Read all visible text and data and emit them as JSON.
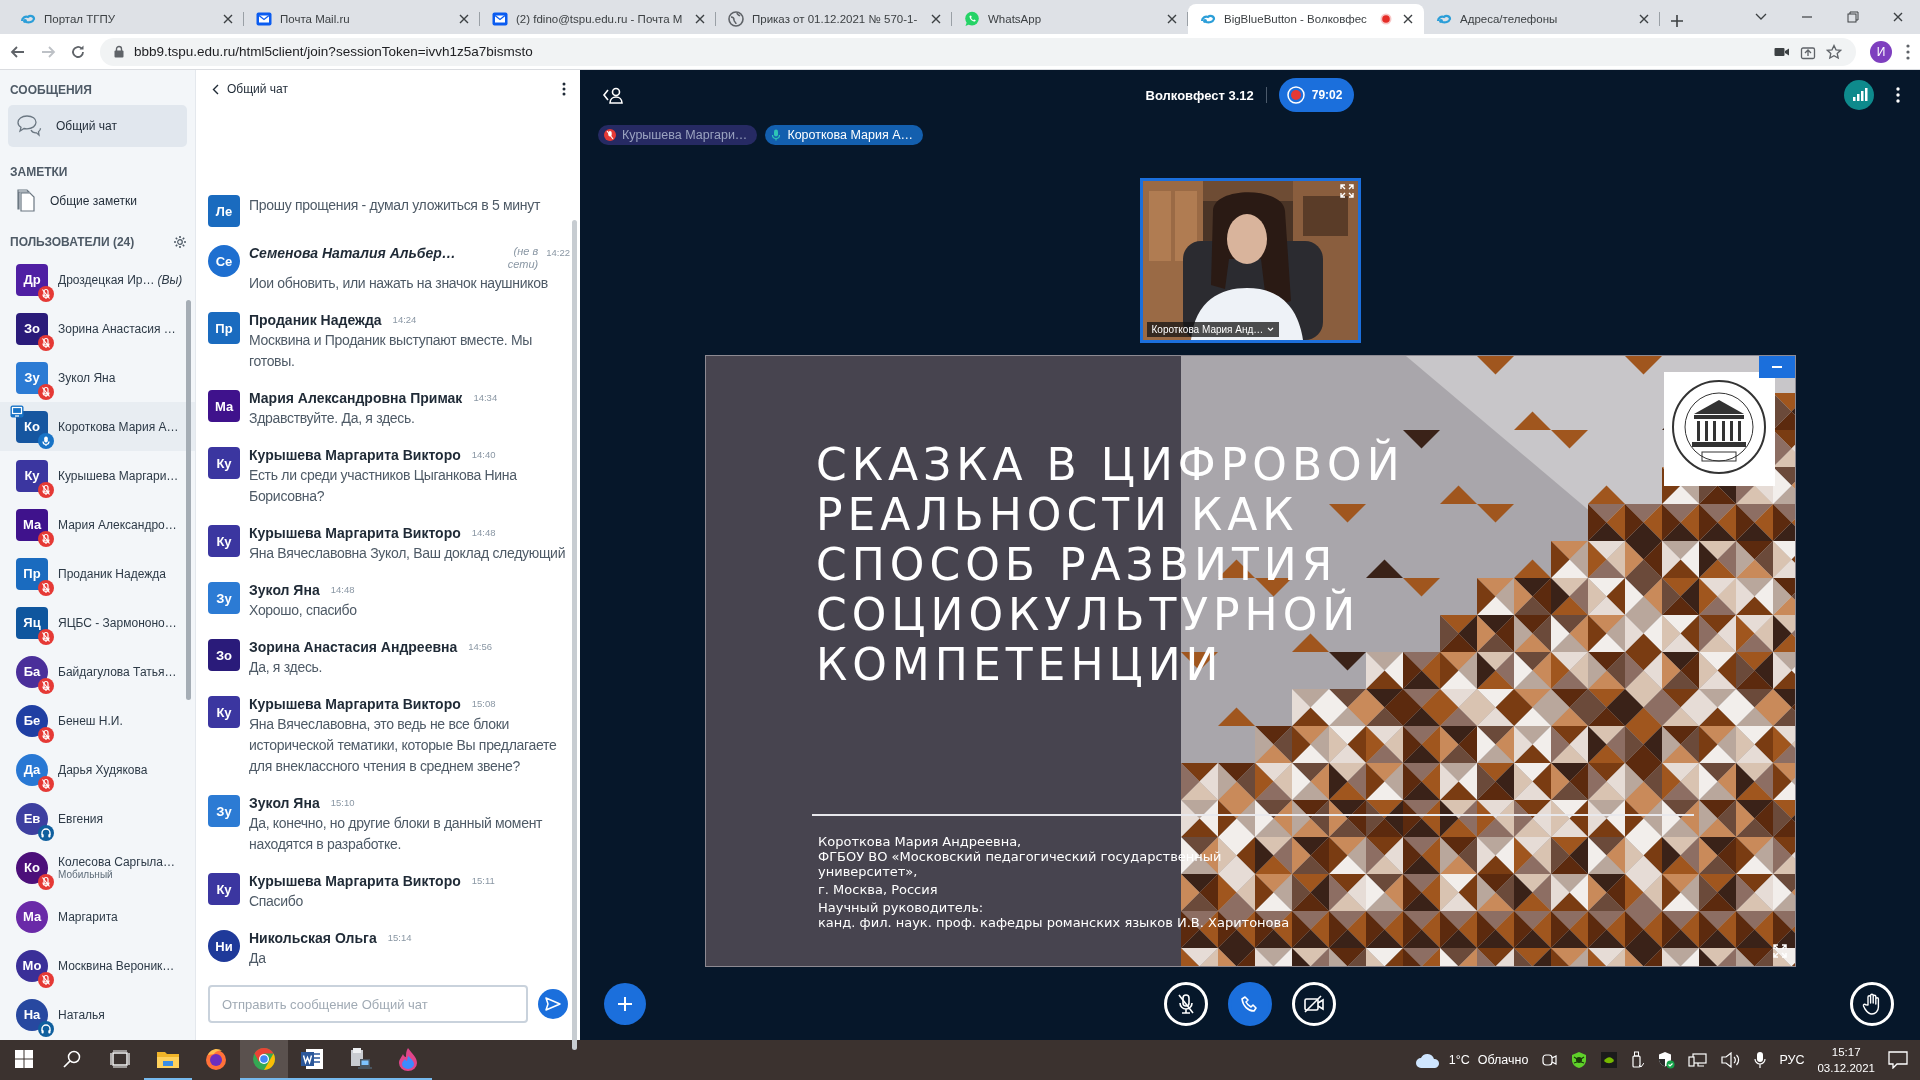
{
  "browser": {
    "tabs": [
      {
        "title": "Портал ТГПУ",
        "kind": "portal",
        "selected": false,
        "recording": false
      },
      {
        "title": "Почта Mail.ru",
        "kind": "mail",
        "selected": false,
        "recording": false
      },
      {
        "title": "(2) fdino@tspu.edu.ru - Почта M",
        "kind": "mail",
        "selected": false,
        "recording": false
      },
      {
        "title": "Приказ от 01.12.2021 № 570-1-",
        "kind": "globe",
        "selected": false,
        "recording": false
      },
      {
        "title": "WhatsApp",
        "kind": "whatsapp",
        "selected": false,
        "recording": false
      },
      {
        "title": "BigBlueButton - Волковфес",
        "kind": "portal",
        "selected": true,
        "recording": true
      },
      {
        "title": "Адреса/телефоны",
        "kind": "portal",
        "selected": false,
        "recording": false
      }
    ],
    "address": "bbb9.tspu.edu.ru/html5client/join?sessionToken=ivvh1z5a7bismsto",
    "profile_initial": "И"
  },
  "sidebar": {
    "messages_title": "СООБЩЕНИЯ",
    "chats": [
      {
        "label": "Общий чат",
        "selected": true
      }
    ],
    "notes_title": "ЗАМЕТКИ",
    "notes": [
      {
        "label": "Общие заметки"
      }
    ],
    "users_title": "ПОЛЬЗОВАТЕЛИ (24)",
    "users": [
      {
        "initials": "Др",
        "name": "Дроздецкая Ир…",
        "you_label": "(Вы)",
        "color": "#4f1fa3",
        "moderator": true,
        "muted": true,
        "listen_only": false,
        "talking": false,
        "presenter": false
      },
      {
        "initials": "Зо",
        "name": "Зорина Анастасия …",
        "color": "#2a1b7a",
        "moderator": true,
        "muted": true,
        "listen_only": false,
        "talking": false,
        "presenter": false
      },
      {
        "initials": "Зу",
        "name": "Зукол Яна",
        "color": "#2c7bd4",
        "moderator": true,
        "muted": true,
        "listen_only": false,
        "talking": false,
        "presenter": false
      },
      {
        "initials": "Ко",
        "name": "Короткова Мария А…",
        "color": "#1656a0",
        "moderator": true,
        "muted": false,
        "listen_only": false,
        "talking": true,
        "presenter": true
      },
      {
        "initials": "Ку",
        "name": "Курышева Маргари…",
        "color": "#3b36a0",
        "moderator": true,
        "muted": true,
        "listen_only": false,
        "talking": false,
        "presenter": false
      },
      {
        "initials": "Ма",
        "name": "Мария Александро…",
        "color": "#3f128c",
        "moderator": true,
        "muted": true,
        "listen_only": false,
        "talking": false,
        "presenter": false
      },
      {
        "initials": "Пр",
        "name": "Проданик Надежда",
        "color": "#1a6bbf",
        "moderator": true,
        "muted": true,
        "listen_only": false,
        "talking": false,
        "presenter": false
      },
      {
        "initials": "Яц",
        "name": "ЯЦБС - Зармононо…",
        "color": "#0f569e",
        "moderator": true,
        "muted": true,
        "listen_only": false,
        "talking": false,
        "presenter": false
      },
      {
        "initials": "Ба",
        "name": "Байдагулова Татья…",
        "color": "#4a2f9a",
        "moderator": false,
        "muted": true,
        "listen_only": false,
        "talking": false,
        "presenter": false
      },
      {
        "initials": "Бе",
        "name": "Бенеш Н.И.",
        "color": "#1f3fa3",
        "moderator": false,
        "muted": true,
        "listen_only": false,
        "talking": false,
        "presenter": false
      },
      {
        "initials": "Да",
        "name": "Дарья Худякова",
        "color": "#2878d4",
        "moderator": false,
        "muted": true,
        "listen_only": false,
        "talking": false,
        "presenter": false
      },
      {
        "initials": "Ев",
        "name": "Евгения",
        "color": "#3d3fa0",
        "moderator": false,
        "muted": false,
        "listen_only": true,
        "talking": false,
        "presenter": false
      },
      {
        "initials": "Ко",
        "name": "Колесова Саргыла…",
        "device": "Мобильный",
        "color": "#4c0f7a",
        "moderator": false,
        "muted": true,
        "listen_only": false,
        "talking": false,
        "presenter": false
      },
      {
        "initials": "Ма",
        "name": "Маргарита",
        "color": "#6a2aa8",
        "moderator": false,
        "muted": false,
        "listen_only": false,
        "talking": false,
        "presenter": false
      },
      {
        "initials": "Мо",
        "name": "Москвина Вероник…",
        "color": "#3a2f98",
        "moderator": false,
        "muted": true,
        "listen_only": false,
        "talking": false,
        "presenter": false
      },
      {
        "initials": "На",
        "name": "Наталья",
        "color": "#2748a0",
        "moderator": false,
        "muted": false,
        "listen_only": true,
        "talking": false,
        "presenter": false
      }
    ]
  },
  "chat": {
    "title": "Общий чат",
    "messages": [
      {
        "initials": "Ле",
        "color": "#1a6bbf",
        "moderator": true,
        "text": "Прошу прощения - думал уложиться в 5 минут"
      },
      {
        "initials": "Се",
        "color": "#1e6fd0",
        "moderator": false,
        "name": "Семенова Наталия Альбер…",
        "offline": true,
        "offline_label": "(не в сети)",
        "time": "14:22",
        "text": "Иои обновить, или нажать на значок наушников"
      },
      {
        "initials": "Пр",
        "color": "#1a6bbf",
        "moderator": true,
        "name": "Проданик Надежда",
        "offline": false,
        "time": "14:24",
        "text": "Москвина и Проданик выступают вместе. Мы готовы."
      },
      {
        "initials": "Ма",
        "color": "#3f128c",
        "moderator": true,
        "name": "Мария Александровна Примак",
        "offline": false,
        "time": "14:34",
        "text": "Здравствуйте. Да, я здесь."
      },
      {
        "initials": "Ку",
        "color": "#3b36a0",
        "moderator": true,
        "name": "Курышева Маргарита Викторо",
        "offline": false,
        "time": "14:40",
        "text": "Есть ли среди участников Цыганкова Нина Борисовна?"
      },
      {
        "initials": "Ку",
        "color": "#3b36a0",
        "moderator": true,
        "name": "Курышева Маргарита Викторо",
        "offline": false,
        "time": "14:48",
        "text": "Яна Вячеславовна Зукол, Ваш доклад следующий"
      },
      {
        "initials": "Зу",
        "color": "#2c7bd4",
        "moderator": true,
        "name": "Зукол Яна",
        "offline": false,
        "time": "14:48",
        "text": "Хорошо, спасибо"
      },
      {
        "initials": "Зо",
        "color": "#2a1b7a",
        "moderator": true,
        "name": "Зорина Анастасия Андреевна",
        "offline": false,
        "time": "14:56",
        "text": "Да, я здесь."
      },
      {
        "initials": "Ку",
        "color": "#3b36a0",
        "moderator": true,
        "name": "Курышева Маргарита Викторо",
        "offline": false,
        "time": "15:08",
        "text": "Яна Вячеславовна, это ведь не все блоки исторической тематики, которые Вы предлагаете для внеклассного чтения в среднем звене?"
      },
      {
        "initials": "Зу",
        "color": "#2c7bd4",
        "moderator": true,
        "name": "Зукол Яна",
        "offline": false,
        "time": "15:10",
        "text": "Да, конечно, но другие блоки в данный момент находятся в разработке."
      },
      {
        "initials": "Ку",
        "color": "#3b36a0",
        "moderator": true,
        "name": "Курышева Маргарита Викторо",
        "offline": false,
        "time": "15:11",
        "text": "Спасибо"
      },
      {
        "initials": "Ни",
        "color": "#1f3a9a",
        "moderator": false,
        "name": "Никольская Ольга",
        "offline": false,
        "time": "15:14",
        "text": "Да"
      }
    ],
    "input": {
      "placeholder": "Отправить сообщение Общий чат"
    }
  },
  "meeting": {
    "title": "Волковфест 3.12",
    "recording": {
      "on": true,
      "time": "79:02"
    },
    "talkers": [
      {
        "name": "Курышева Маргари…",
        "talking": false
      },
      {
        "name": "Короткова Мария А…",
        "talking": true
      }
    ],
    "webcam": {
      "name": "Короткова Мария Анд…"
    },
    "slide": {
      "title": "СКАЗКА В ЦИФРОВОЙ РЕАЛЬНОСТИ КАК СПОСОБ РАЗВИТИЯ СОЦИОКУЛЬТУРНОЙ КОМПЕТЕНЦИИ",
      "paragraphs": [
        "Короткова Мария Андреевна,\nФГБОУ ВО «Московский педагогический государственный\nуниверситет»,",
        "г. Москва, Россия",
        "Научный руководитель:\nканд. фил. наук. проф. кафедры романских языков И.В. Харитонова"
      ]
    }
  },
  "taskbar": {
    "apps": [
      {
        "kind": "start",
        "active": false,
        "running": false
      },
      {
        "kind": "search",
        "active": false,
        "running": false
      },
      {
        "kind": "taskview",
        "active": false,
        "running": false
      },
      {
        "kind": "folder",
        "active": false,
        "running": true
      },
      {
        "kind": "firefox",
        "active": false,
        "running": false
      },
      {
        "kind": "chrome",
        "active": true,
        "running": true
      },
      {
        "kind": "word",
        "active": false,
        "running": true
      },
      {
        "kind": "printer",
        "active": false,
        "running": true
      },
      {
        "kind": "flame",
        "active": false,
        "running": true
      }
    ],
    "weather": {
      "temperature": "1°C",
      "condition": "Облачно"
    },
    "language": "РУС",
    "time": "15:17",
    "date": "03.12.2021"
  }
}
